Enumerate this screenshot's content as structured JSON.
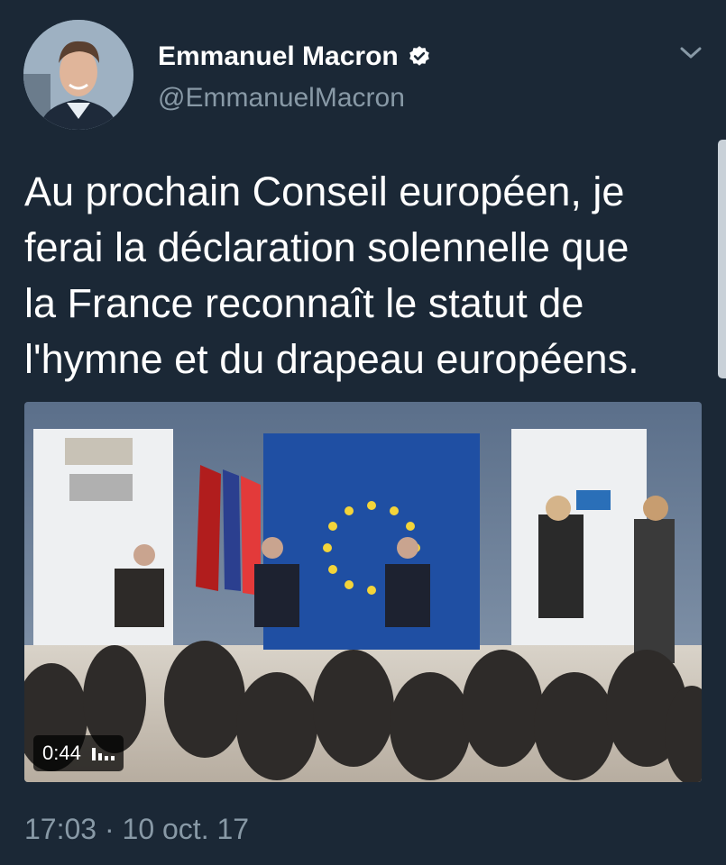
{
  "author": {
    "display_name": "Emmanuel Macron",
    "handle": "@EmmanuelMacron",
    "verified": true
  },
  "tweet": {
    "text": "Au prochain Conseil européen, je\nferai la déclaration solennelle que\nla France reconnaît le statut de\nl'hymne et du drapeau européens."
  },
  "media": {
    "duration": "0:44",
    "icon": "sound-bars-icon"
  },
  "timestamp": "17:03 · 10 oct. 17",
  "colors": {
    "background": "#1b2836",
    "secondary_text": "#8899a6",
    "eu_blue": "#1f4fa3"
  }
}
